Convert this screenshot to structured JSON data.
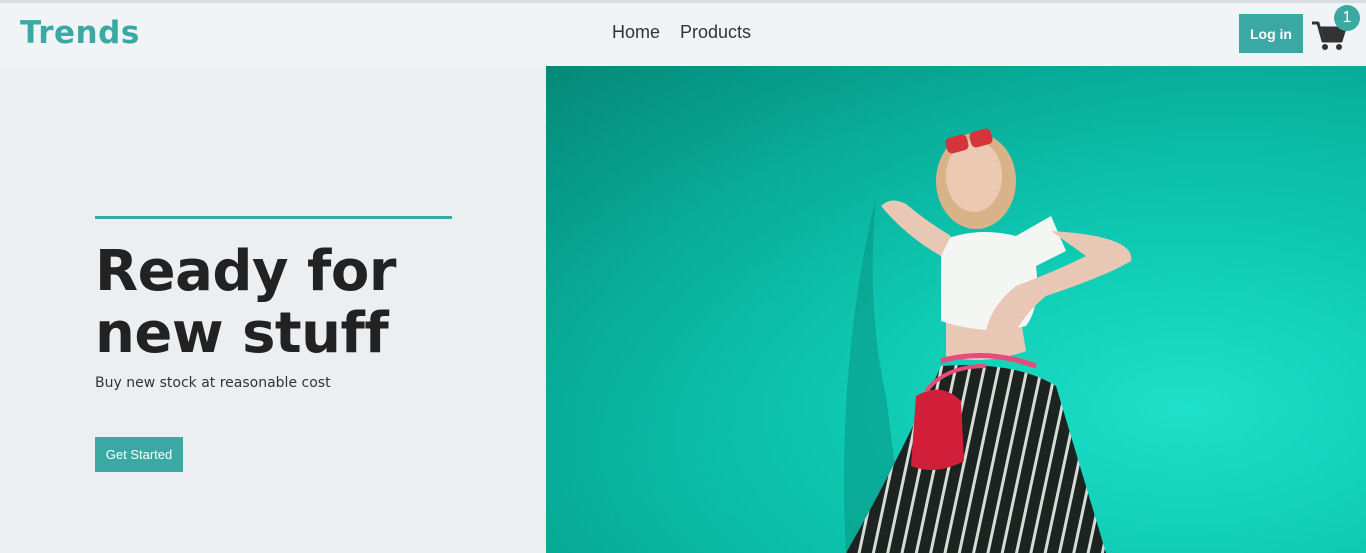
{
  "navbar": {
    "brand": "Trends",
    "links": [
      {
        "label": "Home"
      },
      {
        "label": "Products"
      }
    ],
    "login_label": "Log in",
    "cart_count": "1",
    "cart_icon": "shopping-cart-icon"
  },
  "hero": {
    "title_line1": "Ready for",
    "title_line2": "new stuff",
    "subtitle": "Buy new stock at reasonable cost",
    "cta_label": "Get Started"
  },
  "colors": {
    "accent": "#3aa9a4",
    "hero_bg": "#eceff1",
    "image_wall": "#0fcab3"
  }
}
